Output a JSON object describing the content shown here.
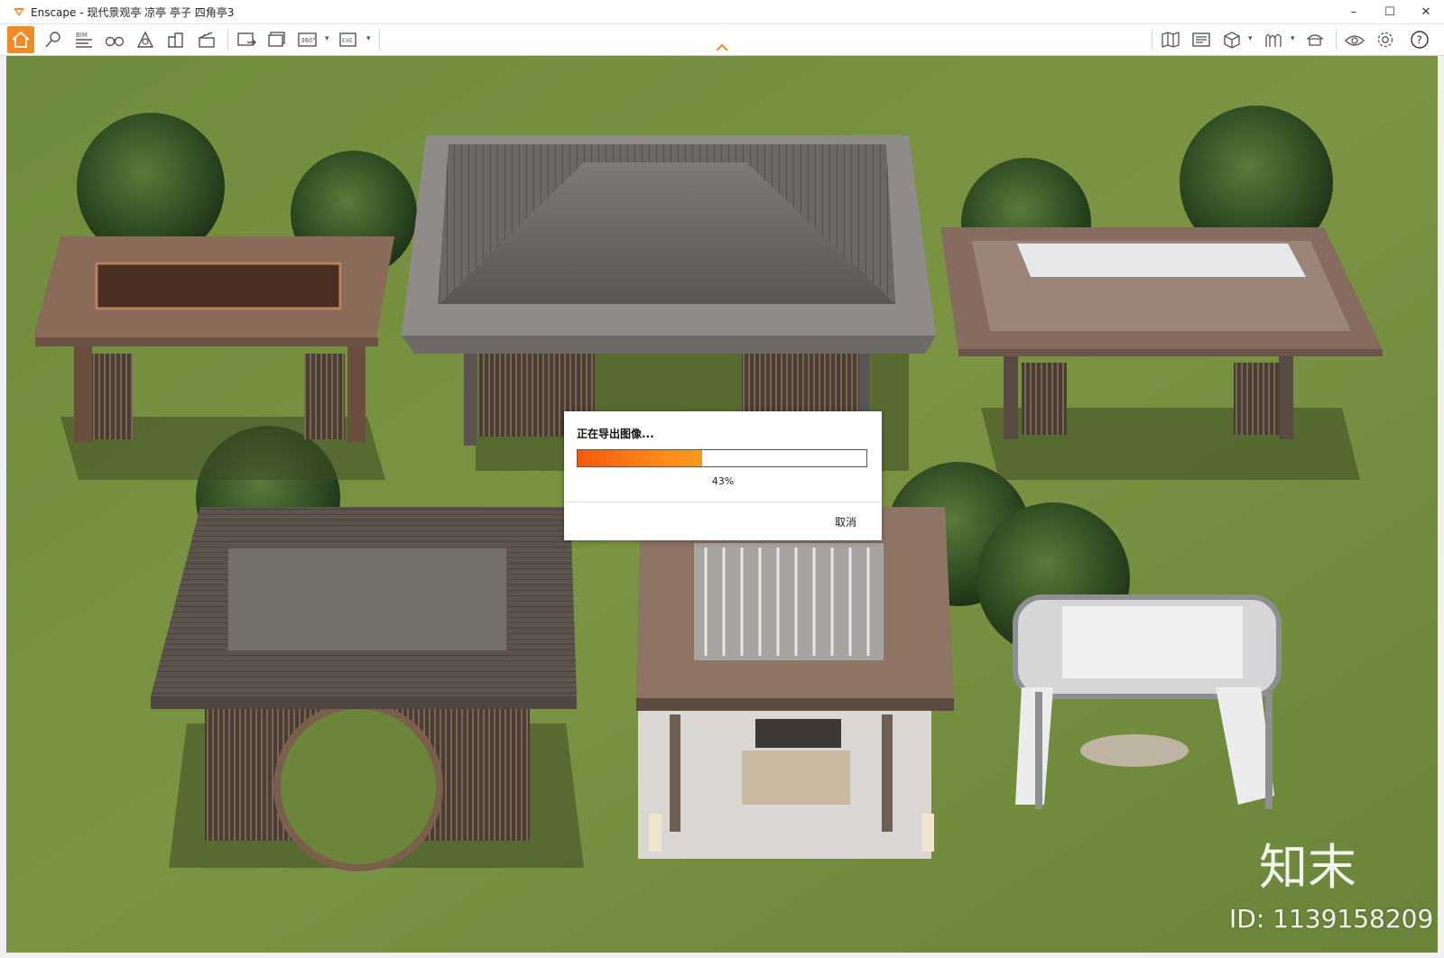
{
  "window": {
    "title": "Enscape - 现代景观亭 凉亭 亭子 四角亭3",
    "minimize_label": "–",
    "maximize_label": "☐",
    "close_label": "✕"
  },
  "toolbar": {
    "left_icons": [
      "home-icon",
      "map-pin-icon",
      "bim-icon",
      "binoculars-icon",
      "asset-library-icon",
      "buildings-icon",
      "clapper-icon",
      "screenshot-icon",
      "batch-render-icon",
      "panorama-360-icon",
      "export-exe-icon"
    ],
    "right_icons": [
      "map-icon",
      "views-icon",
      "cube-icon",
      "materials-icon",
      "cap-icon",
      "eye-icon",
      "gear-icon",
      "help-icon"
    ],
    "bim_label": "BIM",
    "pano_label": "360°",
    "exe_label": "EXE",
    "help_label": "?",
    "accent_color": "#f08a24"
  },
  "dialog": {
    "title": "正在导出图像...",
    "progress_percent": 43,
    "progress_label": "43%",
    "cancel_label": "取消"
  },
  "watermark": {
    "logo_text": "知末",
    "id_text": "ID: 1139158209"
  }
}
